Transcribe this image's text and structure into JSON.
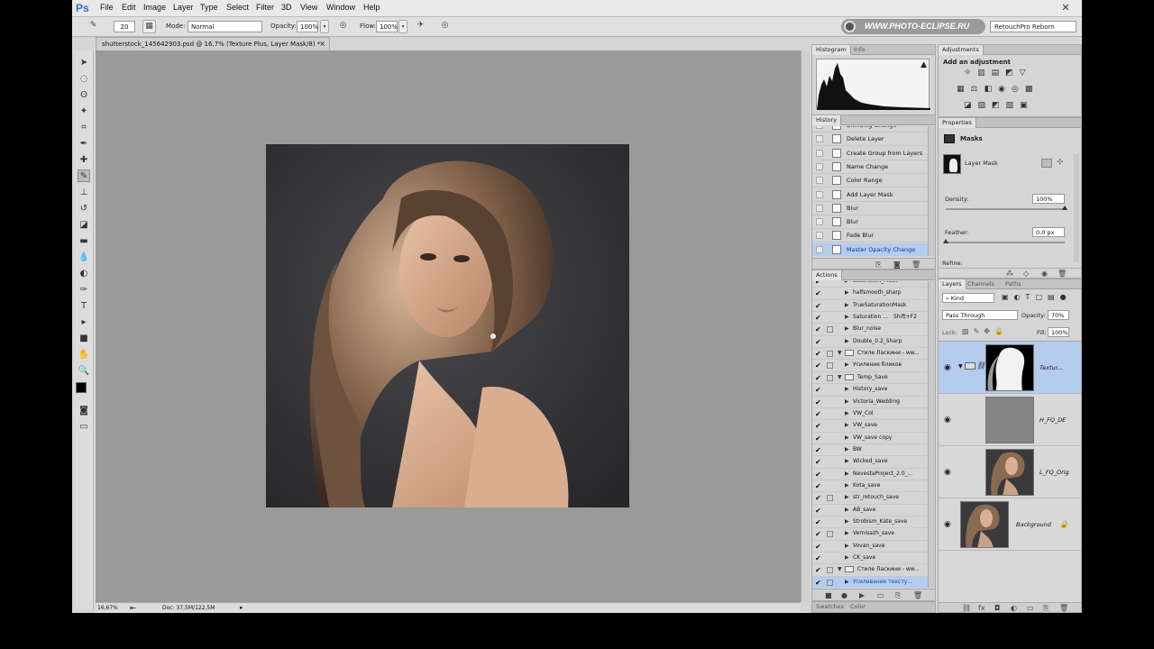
{
  "app": {
    "logo": "Ps",
    "menu": [
      "File",
      "Edit",
      "Image",
      "Layer",
      "Type",
      "Select",
      "Filter",
      "3D",
      "View",
      "Window",
      "Help"
    ],
    "close_glyph": "✕"
  },
  "options": {
    "brush_size": "20",
    "mode_label": "Mode:",
    "mode_value": "Normal",
    "opacity_label": "Opacity:",
    "opacity_value": "100%",
    "flow_label": "Flow:",
    "flow_value": "100%",
    "watermark": "WWW.PHOTO-ECLIPSE.RU",
    "preset": "RetouchPro Reborn"
  },
  "document": {
    "tab_title": "shutterstock_145642903.psd @ 16,7% (Texture Plus, Layer Mask/8) *",
    "zoom": "16,67%",
    "doc_info": "Doc: 37,5M/122,5M"
  },
  "panels": {
    "histogram_tabs": [
      "Histogram",
      "Info"
    ],
    "history_tab": "History",
    "history_items": [
      {
        "label": "Blending Change",
        "selected": false
      },
      {
        "label": "Delete Layer",
        "selected": false
      },
      {
        "label": "Create Group from Layers",
        "selected": false
      },
      {
        "label": "Name Change",
        "selected": false
      },
      {
        "label": "Color Range",
        "selected": false
      },
      {
        "label": "Add Layer Mask",
        "selected": false
      },
      {
        "label": "Blur",
        "selected": false
      },
      {
        "label": "Blur",
        "selected": false
      },
      {
        "label": "Fade Blur",
        "selected": false
      },
      {
        "label": "Master Opacity Change",
        "selected": true
      }
    ],
    "actions_tab": "Actions",
    "action_items": [
      {
        "label": "Saturation_Mask",
        "indent": 1,
        "dialog": false,
        "folder": false,
        "open": false,
        "selected": false
      },
      {
        "label": "halfsmooth_sharp",
        "indent": 1,
        "dialog": false,
        "folder": false,
        "open": false,
        "selected": false
      },
      {
        "label": "TrueSaturationMask",
        "indent": 1,
        "dialog": false,
        "folder": false,
        "open": false,
        "selected": false
      },
      {
        "label": "Saturation ...",
        "shortcut": "Shift+F2",
        "indent": 1,
        "dialog": false,
        "folder": false,
        "open": false,
        "selected": false
      },
      {
        "label": "Blur_noise",
        "indent": 1,
        "dialog": true,
        "folder": false,
        "open": false,
        "selected": false
      },
      {
        "label": "Double_0.2_Sharp",
        "indent": 1,
        "dialog": false,
        "folder": false,
        "open": false,
        "selected": false
      },
      {
        "label": "Стиле Ласкини - ww...",
        "indent": 0,
        "dialog": true,
        "folder": true,
        "open": true,
        "selected": false
      },
      {
        "label": "Усиление бликов",
        "indent": 1,
        "dialog": true,
        "folder": false,
        "open": false,
        "selected": false
      },
      {
        "label": "Temp_Save",
        "indent": 0,
        "dialog": true,
        "folder": true,
        "open": true,
        "selected": false
      },
      {
        "label": "History_save",
        "indent": 1,
        "dialog": false,
        "folder": false,
        "open": false,
        "selected": false
      },
      {
        "label": "Victoria_Wedding",
        "indent": 1,
        "dialog": false,
        "folder": false,
        "open": false,
        "selected": false
      },
      {
        "label": "VW_Col",
        "indent": 1,
        "dialog": false,
        "folder": false,
        "open": false,
        "selected": false
      },
      {
        "label": "VW_save",
        "indent": 1,
        "dialog": false,
        "folder": false,
        "open": false,
        "selected": false
      },
      {
        "label": "VW_save copy",
        "indent": 1,
        "dialog": false,
        "folder": false,
        "open": false,
        "selected": false
      },
      {
        "label": "BW",
        "indent": 1,
        "dialog": false,
        "folder": false,
        "open": false,
        "selected": false
      },
      {
        "label": "Wicked_save",
        "indent": 1,
        "dialog": false,
        "folder": false,
        "open": false,
        "selected": false
      },
      {
        "label": "NevestaProject_2.0_...",
        "indent": 1,
        "dialog": false,
        "folder": false,
        "open": false,
        "selected": false
      },
      {
        "label": "Kota_save",
        "indent": 1,
        "dialog": false,
        "folder": false,
        "open": false,
        "selected": false
      },
      {
        "label": "str_retouch_save",
        "indent": 1,
        "dialog": true,
        "folder": false,
        "open": false,
        "selected": false
      },
      {
        "label": "AB_save",
        "indent": 1,
        "dialog": false,
        "folder": false,
        "open": false,
        "selected": false
      },
      {
        "label": "Strobism_Kate_save",
        "indent": 1,
        "dialog": false,
        "folder": false,
        "open": false,
        "selected": false
      },
      {
        "label": "Vernisazh_save",
        "indent": 1,
        "dialog": true,
        "folder": false,
        "open": false,
        "selected": false
      },
      {
        "label": "Vovan_save",
        "indent": 1,
        "dialog": false,
        "folder": false,
        "open": false,
        "selected": false
      },
      {
        "label": "CK_save",
        "indent": 1,
        "dialog": false,
        "folder": false,
        "open": false,
        "selected": false
      },
      {
        "label": "Стиле Ласкини - ww...",
        "indent": 0,
        "dialog": true,
        "folder": true,
        "open": true,
        "selected": false
      },
      {
        "label": "Усиливание тексту...",
        "indent": 1,
        "dialog": true,
        "folder": false,
        "open": false,
        "selected": true
      }
    ],
    "swatches_tabs": [
      "Swatches",
      "Color"
    ],
    "adjustments_tab": "Adjustments",
    "add_adjustment": "Add an adjustment",
    "properties_tab": "Properties",
    "masks_label": "Masks",
    "layer_mask_label": "Layer Mask",
    "density_label": "Density:",
    "density_value": "100%",
    "density_level": 1.0,
    "feather_label": "Feather:",
    "feather_value": "0,0 px",
    "feather_level": 0.0,
    "refine_label": "Refine:",
    "layers_tabs": [
      "Layers",
      "Channels",
      "Paths"
    ],
    "kind_label": "Kind",
    "blend_mode": "Pass Through",
    "opacity_label": "Opacity:",
    "opacity_value": "70%",
    "lock_label": "Lock:",
    "fill_label": "Fill:",
    "fill_value": "100%",
    "layers": [
      {
        "name": "Textur...",
        "kind": "group-mask",
        "selected": true
      },
      {
        "name": "H_FQ_DE",
        "kind": "gray",
        "selected": false
      },
      {
        "name": "L_FQ_Orig",
        "kind": "photo",
        "selected": false
      },
      {
        "name": "Background",
        "kind": "photo",
        "selected": false,
        "locked": true
      }
    ]
  },
  "colors": {
    "selection": "#b4ccee",
    "ps_blue": "#2f6fbf",
    "doc_bg": "#9a9a9a"
  }
}
